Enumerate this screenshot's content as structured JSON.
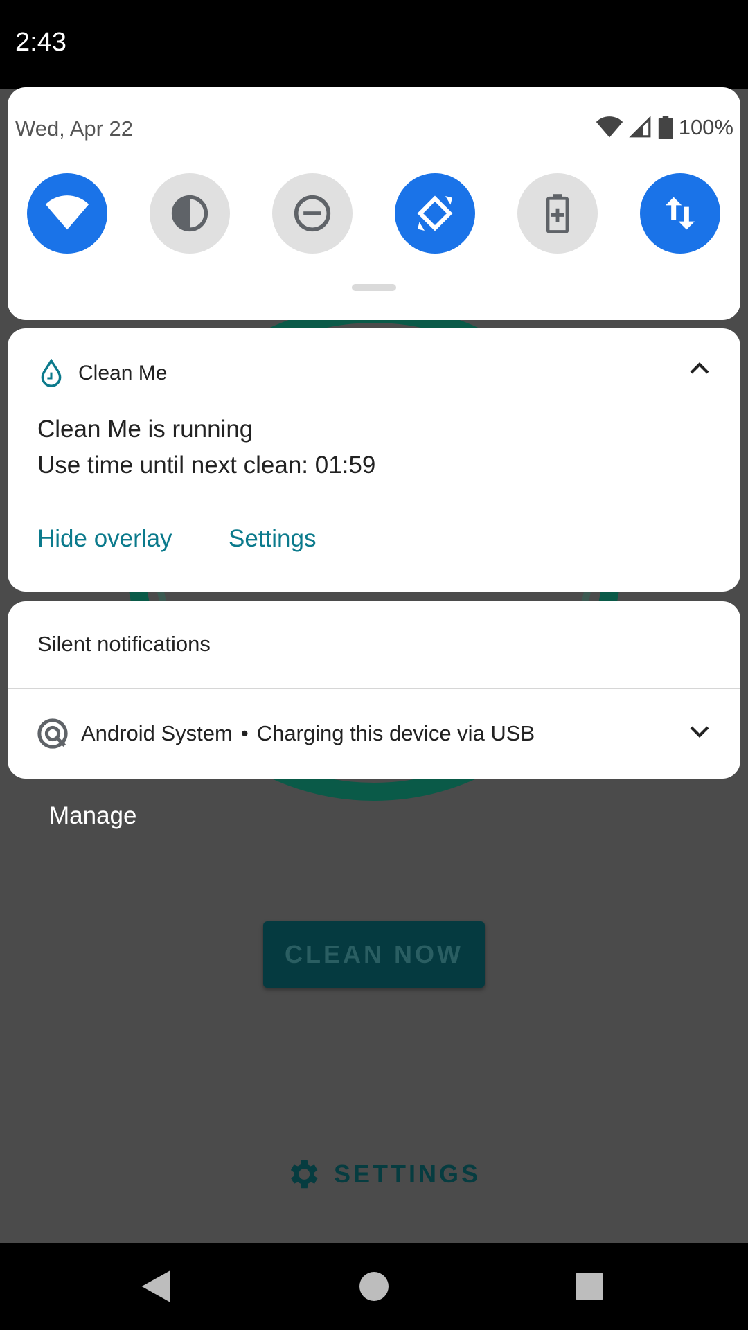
{
  "status_bar": {
    "time": "2:43"
  },
  "quick_settings": {
    "date": "Wed, Apr 22",
    "battery_percent": "100%",
    "tiles": [
      {
        "name": "wifi",
        "icon": "wifi-icon",
        "active": true
      },
      {
        "name": "dark-theme",
        "icon": "contrast-icon",
        "active": false
      },
      {
        "name": "do-not-disturb",
        "icon": "dnd-icon",
        "active": false
      },
      {
        "name": "auto-rotate",
        "icon": "rotate-icon",
        "active": true
      },
      {
        "name": "battery-saver",
        "icon": "battery-saver-icon",
        "active": false
      },
      {
        "name": "mobile-data",
        "icon": "data-arrows-icon",
        "active": true
      }
    ]
  },
  "notification": {
    "app_name": "Clean Me",
    "title": "Clean Me is running",
    "text": "Use time until next clean: 01:59",
    "actions": [
      "Hide overlay",
      "Settings"
    ],
    "accent": "#0b7a8c"
  },
  "silent": {
    "header": "Silent notifications",
    "app": "Android System",
    "separator": "•",
    "text": "Charging this device via USB"
  },
  "manage_label": "Manage",
  "background_app": {
    "clean_now_label": "CLEAN NOW",
    "settings_label": "SETTINGS"
  },
  "colors": {
    "tile_on": "#1a73e8",
    "tile_off": "#e0e0e0"
  }
}
